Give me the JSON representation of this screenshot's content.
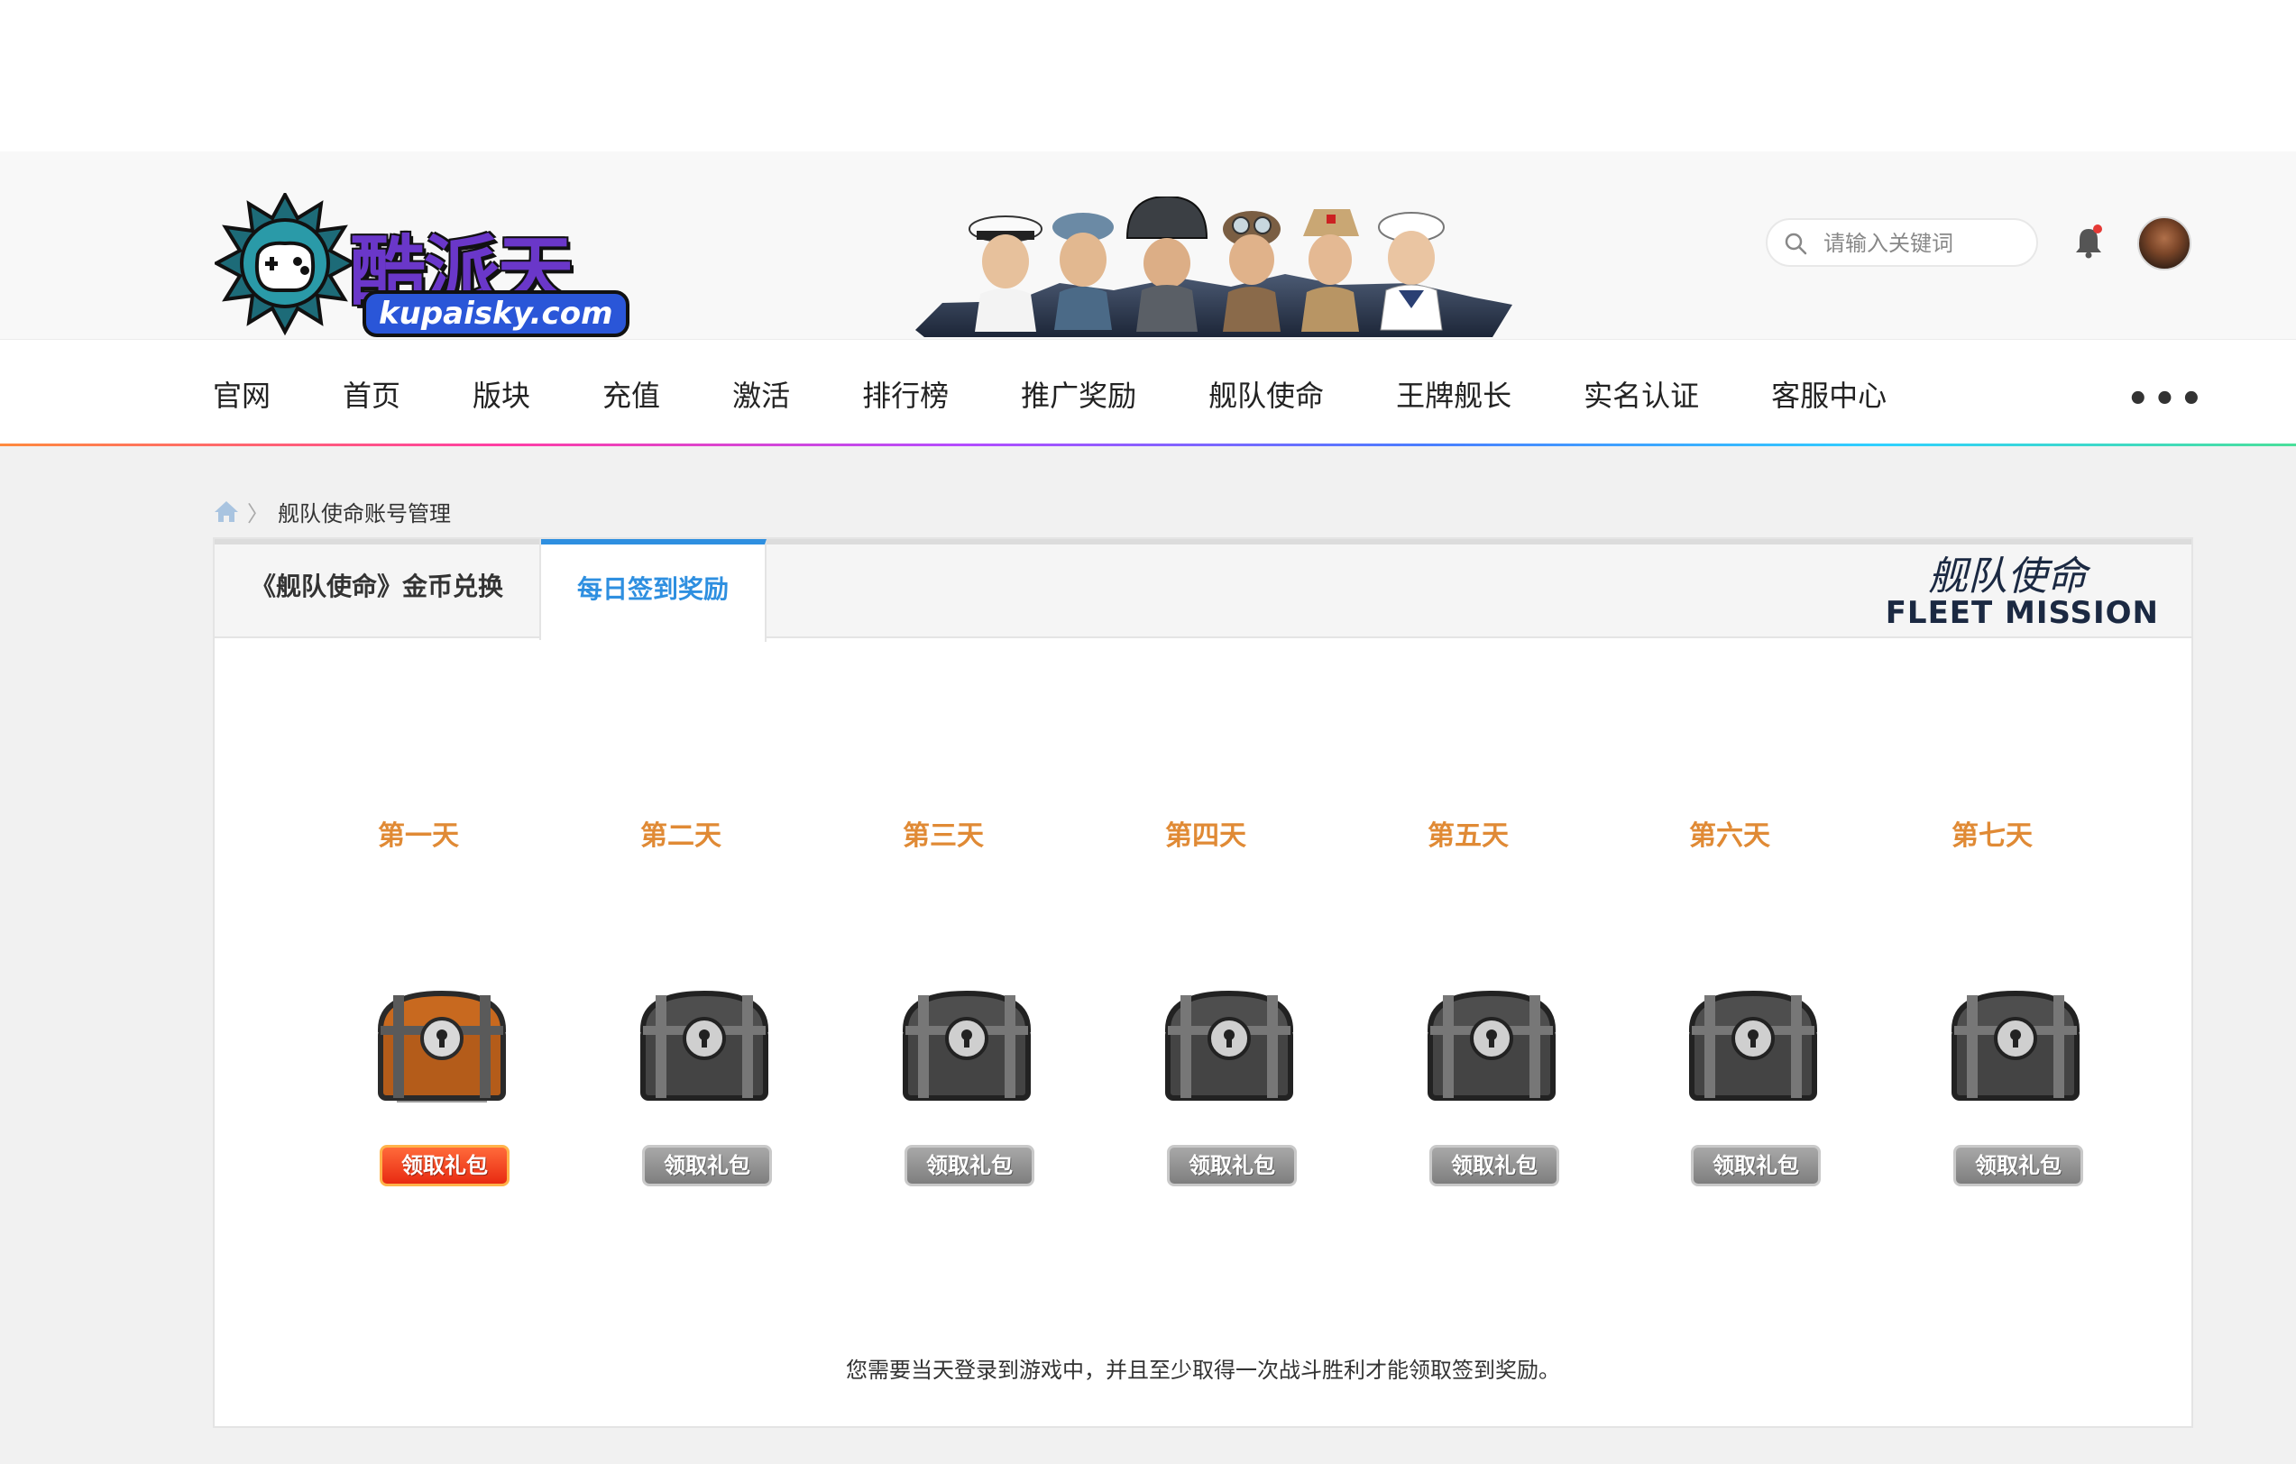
{
  "site": {
    "logo_cn": "酷派天空",
    "logo_en": "kupaisky.com"
  },
  "search": {
    "placeholder": "请输入关键词"
  },
  "nav": {
    "items": [
      "官网",
      "首页",
      "版块",
      "充值",
      "激活",
      "排行榜",
      "推广奖励",
      "舰队使命",
      "王牌舰长",
      "实名认证",
      "客服中心"
    ],
    "more": "•••"
  },
  "breadcrumb": {
    "current": "舰队使命账号管理",
    "separator": "〉"
  },
  "tabs": [
    {
      "label": "《舰队使命》金币兑换",
      "active": false
    },
    {
      "label": "每日签到奖励",
      "active": true
    }
  ],
  "brand": {
    "cn": "舰队使命",
    "en": "FLEET MISSION"
  },
  "days": [
    {
      "label": "第一天",
      "button": "领取礼包",
      "available": true
    },
    {
      "label": "第二天",
      "button": "领取礼包",
      "available": false
    },
    {
      "label": "第三天",
      "button": "领取礼包",
      "available": false
    },
    {
      "label": "第四天",
      "button": "领取礼包",
      "available": false
    },
    {
      "label": "第五天",
      "button": "领取礼包",
      "available": false
    },
    {
      "label": "第六天",
      "button": "领取礼包",
      "available": false
    },
    {
      "label": "第七天",
      "button": "领取礼包",
      "available": false
    }
  ],
  "notice": "您需要当天登录到游戏中，并且至少取得一次战斗胜利才能领取签到奖励。",
  "colors": {
    "accent": "#2e8fe0",
    "day_label": "#e08a35",
    "claim_active": "#e82a12",
    "claim_disabled": "#8a8a8a",
    "chest_active": "#c8691f",
    "chest_locked": "#555555"
  }
}
